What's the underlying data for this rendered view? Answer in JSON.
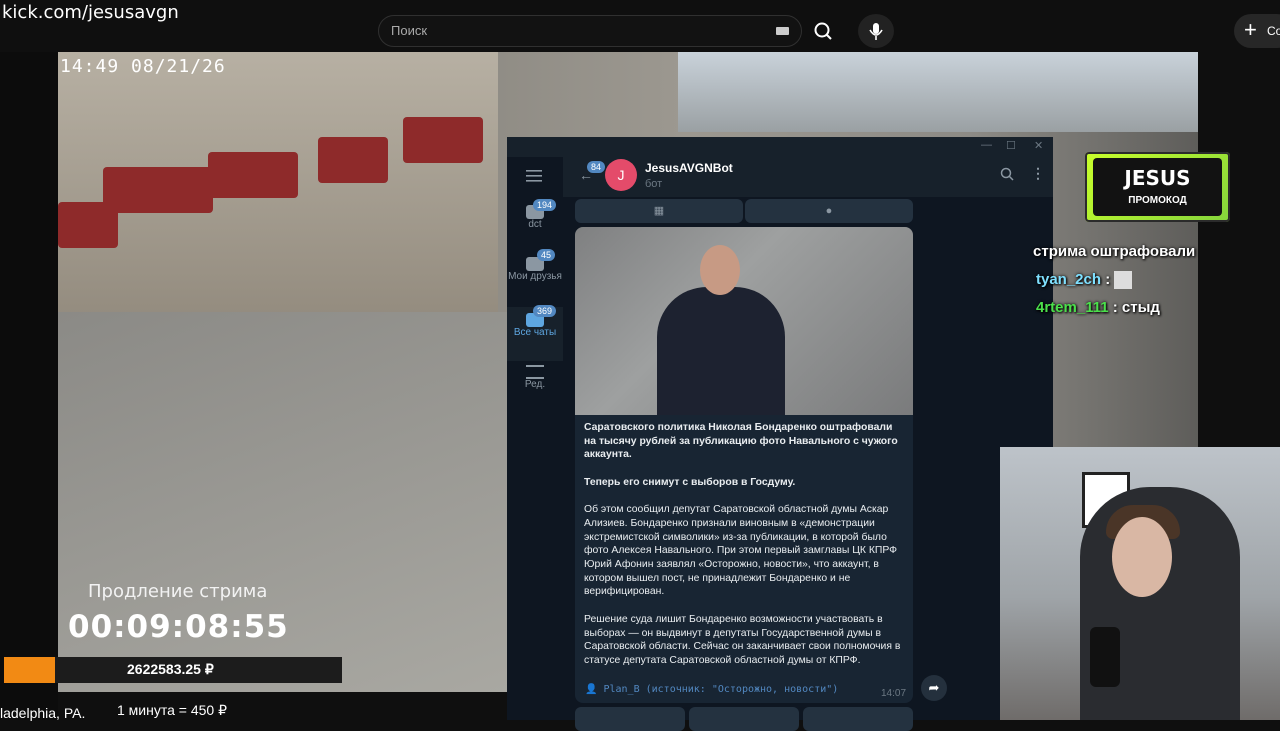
{
  "browser": {
    "url": "kick.com/jesusavgn",
    "search_placeholder": "Поиск",
    "create_label": "Со"
  },
  "video": {
    "timestamp": "14:49 08/21/26",
    "extension_label": "Продление стрима",
    "extension_timer": "00:09:08:55",
    "donation_total": "2622583.25 ₽",
    "donation_progress_fraction": 0.15,
    "location_text": "ladelphia, PA.",
    "rate_text": "1 минута = 450 ₽",
    "accent_color": "#f28a14"
  },
  "telegram": {
    "rail": {
      "back_badge": "84",
      "folders": [
        {
          "label": "dct",
          "badge": "194"
        },
        {
          "label": "Мои друзья",
          "badge": "45"
        },
        {
          "label": "Все чаты",
          "badge": "369"
        },
        {
          "label": "Ред.",
          "badge": ""
        }
      ]
    },
    "chat": {
      "avatar_letter": "J",
      "name": "JesusAVGNBot",
      "status": "бот"
    },
    "message": {
      "headline": "Саратовского политика Николая Бондаренко оштрафовали на тысячу рублей за публикацию фото Навального с чужого аккаунта.",
      "subheadline": "Теперь его снимут с выборов в Госдуму.",
      "para1": "Об этом сообщил депутат Саратовской областной думы Аскар Ализиев. Бондаренко признали виновным в «демонстрации экстремистской символики» из-за публикации, в которой было фото Алексея Навального. При этом первый замглавы ЦК КПРФ Юрий Афонин заявлял «Осторожно, новости», что аккаунт, в котором вышел пост, не принадлежит Бондаренко и не верифицирован.",
      "para2": "Решение суда лишит Бондаренко возможности участвовать в выборах — он выдвинут в депутаты Государственной думы в Саратовской области. Сейчас он заканчивает свои полномочия в статусе депутата Саратовской областной думы от КПРФ.",
      "signature": "👤 Plan_B (источник: \"Осторожно, новости\")",
      "time": "14:07"
    }
  },
  "promo": {
    "name": "JESUS",
    "sub": "ПРОМОКОД"
  },
  "chat_overlay": {
    "line1": "стрима оштрафовали",
    "line2_user": "tyan_2ch",
    "line2_sep": " :",
    "line3_user": "4rtem_111",
    "line3_msg": " : стыд",
    "user2_color": "#7fe0ff",
    "user3_color": "#4be04b"
  }
}
